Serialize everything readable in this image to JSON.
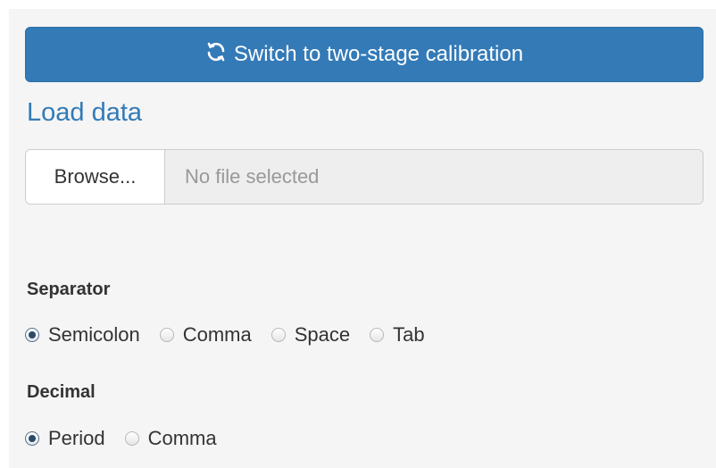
{
  "switch_button": {
    "label": "Switch to two-stage calibration",
    "icon": "refresh-icon"
  },
  "load_data": {
    "title": "Load data",
    "browse_label": "Browse...",
    "file_placeholder": "No file selected"
  },
  "separator": {
    "label": "Separator",
    "options": [
      "Semicolon",
      "Comma",
      "Space",
      "Tab"
    ],
    "selected": "Semicolon"
  },
  "decimal": {
    "label": "Decimal",
    "options": [
      "Period",
      "Comma"
    ],
    "selected": "Period"
  },
  "colors": {
    "primary": "#337ab7",
    "panel_bg": "#f5f5f5"
  }
}
